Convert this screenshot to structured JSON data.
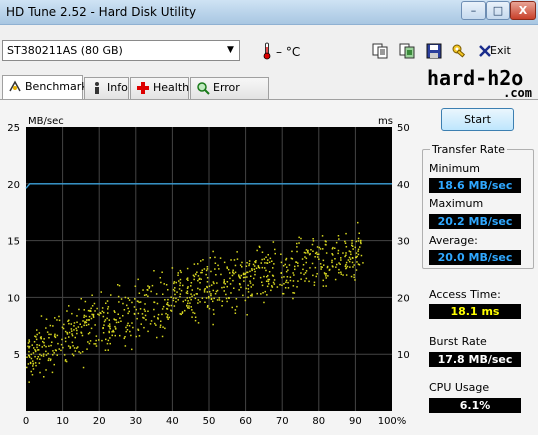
{
  "window": {
    "title": "HD Tune 2.52 - Hard Disk Utility",
    "minimize": "–",
    "maximize": "□",
    "close": "X"
  },
  "toolbar": {
    "drive_selected": "ST380211AS (80 GB)",
    "temperature": "– °C",
    "exit_label": "Exit",
    "icons": [
      "copy-icon",
      "copy-screenshot-icon",
      "save-icon",
      "options-icon",
      "exit-icon"
    ]
  },
  "logo": {
    "line1": "hard-h2o",
    "line2": ".com"
  },
  "tabs": [
    {
      "label": "Benchmark",
      "icon": "benchmark-icon",
      "active": true
    },
    {
      "label": "Info",
      "icon": "info-icon",
      "active": false
    },
    {
      "label": "Health",
      "icon": "health-icon",
      "active": false
    },
    {
      "label": "Error Scan",
      "icon": "error-scan-icon",
      "active": false
    }
  ],
  "side": {
    "start_label": "Start",
    "transfer_rate_title": "Transfer Rate",
    "minimum_label": "Minimum",
    "minimum_value": "18.6 MB/sec",
    "maximum_label": "Maximum",
    "maximum_value": "20.2 MB/sec",
    "average_label": "Average:",
    "average_value": "20.0 MB/sec",
    "access_label": "Access Time:",
    "access_value": "18.1 ms",
    "burst_label": "Burst Rate",
    "burst_value": "17.8 MB/sec",
    "cpu_label": "CPU Usage",
    "cpu_value": "6.1%"
  },
  "chart_data": {
    "type": "line",
    "left_axis_label": "MB/sec",
    "right_axis_label": "ms",
    "left_ylim": [
      0,
      25
    ],
    "right_ylim": [
      0,
      50
    ],
    "xlim": [
      0,
      100
    ],
    "left_ticks": [
      5,
      10,
      15,
      20,
      25
    ],
    "right_ticks": [
      10,
      20,
      30,
      40,
      50
    ],
    "x_ticks": [
      "0",
      "10",
      "20",
      "30",
      "40",
      "50",
      "60",
      "70",
      "80",
      "90",
      "100%"
    ],
    "x_tick_values": [
      0,
      10,
      20,
      30,
      40,
      50,
      60,
      70,
      80,
      90,
      100
    ],
    "grid": true,
    "colors": {
      "background": "#000000",
      "grid": "#444444",
      "transfer": "#3a9fd8",
      "access": "#d8d820"
    },
    "series": [
      {
        "name": "Transfer Rate",
        "axis": "left",
        "x": [
          0,
          1,
          2,
          5,
          10,
          15,
          20,
          25,
          30,
          35,
          40,
          45,
          50,
          55,
          60,
          65,
          70,
          75,
          80,
          85,
          90,
          95,
          100
        ],
        "y": [
          19.6,
          20.0,
          20.0,
          20.0,
          20.0,
          20.0,
          20.0,
          20.0,
          20.0,
          20.0,
          20.0,
          20.0,
          20.0,
          20.0,
          20.0,
          20.0,
          20.0,
          20.0,
          20.0,
          20.0,
          20.0,
          20.0,
          20.0
        ]
      },
      {
        "name": "Access Time",
        "axis": "right",
        "type": "scatter",
        "trend_x": [
          0,
          10,
          20,
          30,
          40,
          50,
          60,
          70,
          80,
          90
        ],
        "trend_low": [
          4,
          6,
          8,
          10,
          12,
          14,
          16,
          18,
          20,
          22
        ],
        "trend_high": [
          16,
          20,
          23,
          26,
          28,
          30,
          31,
          32,
          33,
          34
        ]
      }
    ]
  }
}
